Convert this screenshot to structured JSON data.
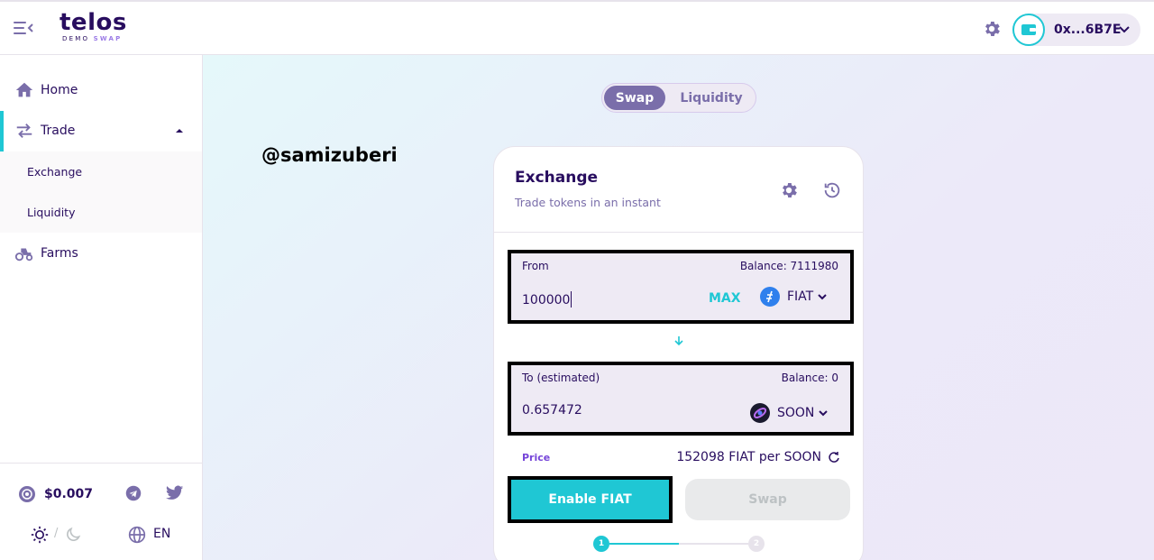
{
  "header": {
    "logo_text": "telos",
    "logo_sub_1": "DEMO",
    "logo_sub_2": "SWAP",
    "wallet_address": "0x...6B7E"
  },
  "sidebar": {
    "items": [
      {
        "label": "Home",
        "icon": "home-icon"
      },
      {
        "label": "Trade",
        "icon": "trade-icon",
        "expanded": true
      },
      {
        "label": "Farms",
        "icon": "farms-icon"
      }
    ],
    "trade_subitems": [
      {
        "label": "Exchange",
        "active": true
      },
      {
        "label": "Liquidity",
        "active": false
      }
    ],
    "footer": {
      "token_price": "$0.007",
      "language": "EN",
      "theme_separator": "/"
    }
  },
  "main": {
    "tabs": [
      {
        "label": "Swap",
        "active": true
      },
      {
        "label": "Liquidity",
        "active": false
      }
    ],
    "watermark": "@samizuberi",
    "card": {
      "title": "Exchange",
      "subtitle": "Trade tokens in an instant",
      "from": {
        "label": "From",
        "balance": "Balance: 7111980",
        "value": "100000",
        "max_label": "MAX",
        "token": "FIAT"
      },
      "to": {
        "label": "To (estimated)",
        "balance": "Balance: 0",
        "value": "0.657472",
        "token": "SOON"
      },
      "price_label": "Price",
      "price_value": "152098 FIAT per SOON",
      "enable_label": "Enable FIAT",
      "swap_label": "Swap",
      "steps": [
        "1",
        "2"
      ],
      "current_step": 1
    }
  },
  "colors": {
    "primary": "#1fc7d4",
    "secondary": "#7a6eaa",
    "text": "#280d5f",
    "price_label": "#7645d9",
    "input_bg": "#eeeaf4"
  }
}
